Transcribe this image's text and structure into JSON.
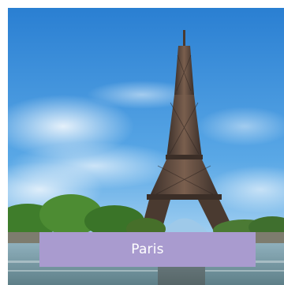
{
  "tile": {
    "caption": "Paris",
    "photo_subject": "eiffel-tower",
    "colors": {
      "sky_top": "#2f86d6",
      "sky_bottom": "#bfe0f5",
      "trees": "#3f7d2b",
      "water": "#7a9aa6",
      "caption_bg": "#a99bcf",
      "caption_text": "#ffffff"
    }
  }
}
